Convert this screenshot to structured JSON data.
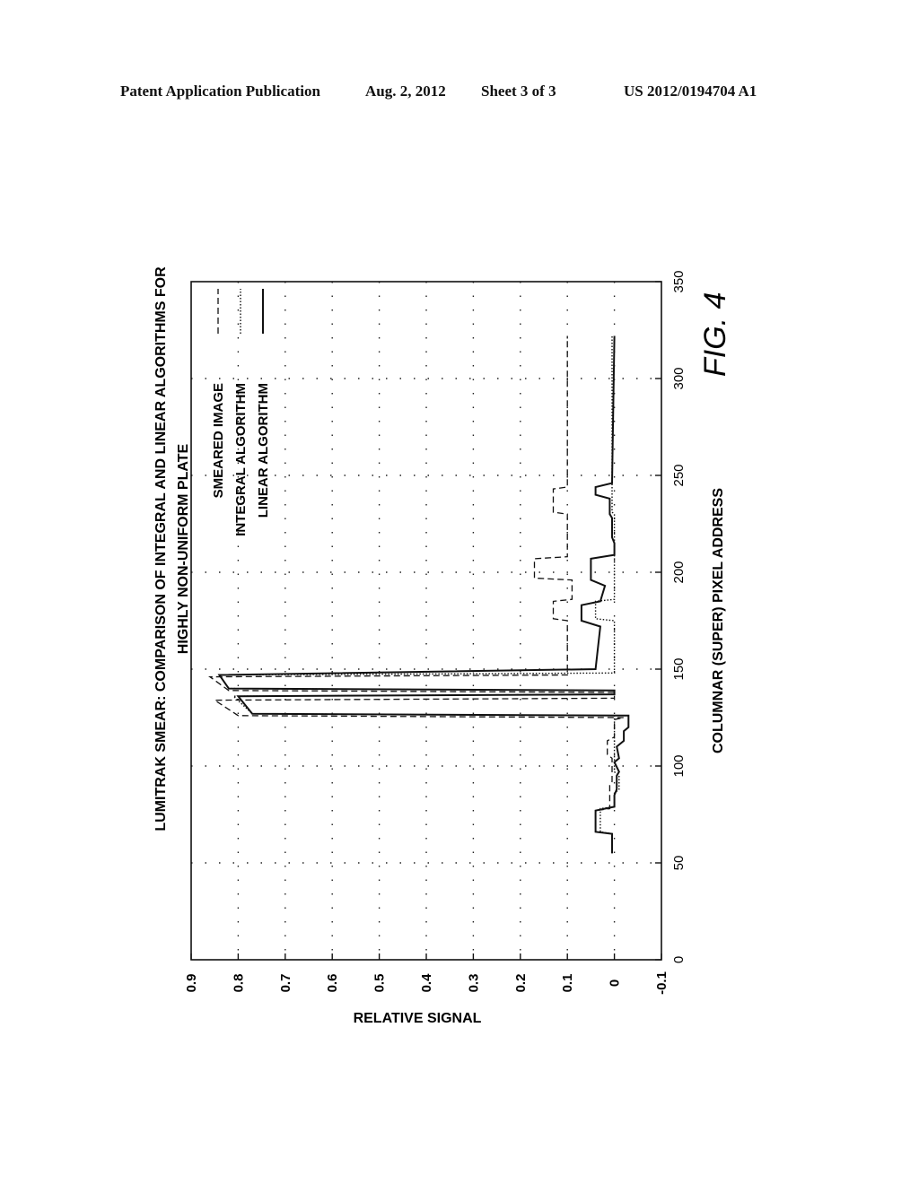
{
  "header": {
    "publication": "Patent Application Publication",
    "date": "Aug. 2, 2012",
    "sheet": "Sheet 3 of 3",
    "number": "US 2012/0194704 A1"
  },
  "figure_label": "FIG. 4",
  "chart_data": {
    "type": "line",
    "orientation": "rotated 90° counterclockwise on page",
    "title": "LUMITRAK SMEAR: COMPARISON OF INTEGRAL AND LINEAR ALGORITHMS FOR HIGHLY NON-UNIFORM PLATE",
    "title_lines": [
      "LUMITRAK SMEAR: COMPARISON OF INTEGRAL AND LINEAR ALGORITHMS FOR",
      "HIGHLY NON-UNIFORM PLATE"
    ],
    "xlabel": "COLUMNAR (SUPER) PIXEL ADDRESS",
    "ylabel": "RELATIVE SIGNAL",
    "xlim": [
      0,
      350
    ],
    "ylim": [
      -0.1,
      0.9
    ],
    "xticks": [
      "0",
      "50",
      "100",
      "150",
      "200",
      "250",
      "300",
      "350"
    ],
    "yticks": [
      "-0.1",
      "0",
      "0.1",
      "0.2",
      "0.3",
      "0.4",
      "0.5",
      "0.6",
      "0.7",
      "0.8",
      "0.9"
    ],
    "grid": "dotted",
    "legend_position": "top-left",
    "series": [
      {
        "name": "SMEARED IMAGE",
        "style": "dashed",
        "points": [
          [
            55,
            0.005
          ],
          [
            65,
            0.005
          ],
          [
            66,
            0.04
          ],
          [
            77,
            0.04
          ],
          [
            78,
            0.01
          ],
          [
            90,
            0.01
          ],
          [
            92,
            0.005
          ],
          [
            104,
            0.005
          ],
          [
            106,
            0.015
          ],
          [
            113,
            0.015
          ],
          [
            115,
            0.0
          ],
          [
            124,
            0.0
          ],
          [
            125,
            -0.02
          ],
          [
            126,
            0.8
          ],
          [
            134,
            0.85
          ],
          [
            135,
            0.0
          ],
          [
            138,
            0.0
          ],
          [
            139,
            0.82
          ],
          [
            146,
            0.86
          ],
          [
            147,
            0.1
          ],
          [
            175,
            0.1
          ],
          [
            176,
            0.13
          ],
          [
            185,
            0.13
          ],
          [
            186,
            0.09
          ],
          [
            196,
            0.09
          ],
          [
            197,
            0.17
          ],
          [
            207,
            0.17
          ],
          [
            208,
            0.1
          ],
          [
            230,
            0.1
          ],
          [
            231,
            0.13
          ],
          [
            243,
            0.13
          ],
          [
            244,
            0.1
          ],
          [
            322,
            0.1
          ]
        ]
      },
      {
        "name": "INTEGRAL ALGORITHM",
        "style": "dotted",
        "points": [
          [
            55,
            0.005
          ],
          [
            65,
            0.005
          ],
          [
            66,
            0.03
          ],
          [
            78,
            0.03
          ],
          [
            79,
            0.0
          ],
          [
            86,
            0.0
          ],
          [
            88,
            -0.01
          ],
          [
            95,
            -0.01
          ],
          [
            97,
            0.0
          ],
          [
            112,
            0.0
          ],
          [
            113,
            0.0
          ],
          [
            126,
            0.0
          ],
          [
            127,
            0.77
          ],
          [
            136,
            0.81
          ],
          [
            137,
            0.0
          ],
          [
            139,
            0.0
          ],
          [
            140,
            0.82
          ],
          [
            147,
            0.84
          ],
          [
            148,
            0.0
          ],
          [
            175,
            0.0
          ],
          [
            176,
            0.04
          ],
          [
            185,
            0.04
          ],
          [
            186,
            0.0
          ],
          [
            230,
            0.0
          ],
          [
            231,
            0.005
          ],
          [
            322,
            0.005
          ]
        ]
      },
      {
        "name": "LINEAR ALGORITHM",
        "style": "solid",
        "points": [
          [
            55,
            0.005
          ],
          [
            65,
            0.005
          ],
          [
            66,
            0.04
          ],
          [
            77,
            0.04
          ],
          [
            79,
            0.0
          ],
          [
            85,
            0.0
          ],
          [
            88,
            -0.005
          ],
          [
            95,
            -0.005
          ],
          [
            97,
            -0.01
          ],
          [
            102,
            0.0
          ],
          [
            104,
            -0.01
          ],
          [
            110,
            -0.005
          ],
          [
            113,
            -0.02
          ],
          [
            118,
            -0.02
          ],
          [
            120,
            -0.03
          ],
          [
            126,
            -0.03
          ],
          [
            127,
            0.77
          ],
          [
            136,
            0.8
          ],
          [
            137,
            0.0
          ],
          [
            139,
            0.0
          ],
          [
            140,
            0.82
          ],
          [
            147,
            0.84
          ],
          [
            150,
            0.04
          ],
          [
            172,
            0.03
          ],
          [
            175,
            0.07
          ],
          [
            183,
            0.07
          ],
          [
            185,
            0.03
          ],
          [
            193,
            0.02
          ],
          [
            196,
            0.05
          ],
          [
            207,
            0.05
          ],
          [
            209,
            0.0
          ],
          [
            215,
            0.0
          ],
          [
            218,
            0.005
          ],
          [
            228,
            0.005
          ],
          [
            230,
            0.01
          ],
          [
            238,
            0.01
          ],
          [
            240,
            0.04
          ],
          [
            244,
            0.04
          ],
          [
            246,
            0.005
          ],
          [
            322,
            0.0
          ]
        ]
      }
    ]
  }
}
